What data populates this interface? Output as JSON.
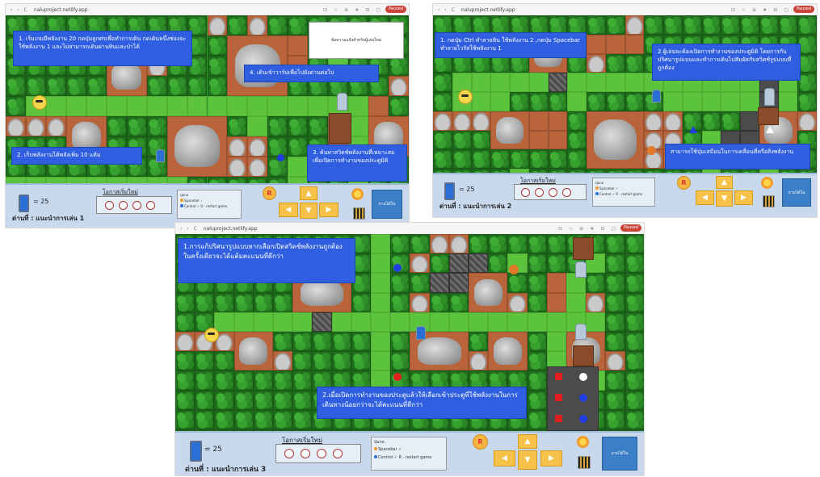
{
  "browser": {
    "url": "naluproject.netlify.app",
    "nav_glyphs": "‹ › C",
    "toolbar_glyphs": "⊡ ☆ ⊕ ★ ⊟ ▢",
    "profile_label": "Paused"
  },
  "screens": [
    {
      "notes": {
        "n1": "1. เริ่มเกมมีพลังงาน 20 กดปุ่มลูกศรเพื่อทำการเดิน กดเดินหนึ่งช่องจะใช้พลังงาน 1 และไม่สามารถเดินผ่านหินและป่าได้",
        "n2": "4. เดินเข้าวาร์ปเพื่อไปยังด่านต่อไป",
        "n3": "2. เก็บพลังงานได้พลังเพิ่ม 10 แต้ม",
        "n4": "3. ค้นหาสวิตช์พลังงานที่เหมาะสมเพื่อเปิดการทำงานของประตูมิติ"
      },
      "popup": "ข้อความแจ้งสำหรับผู้เล่นใหม่",
      "hud": {
        "energy": "= 25",
        "restart_label": "โอกาสเริ่มใหม่",
        "stage": "ด่านที่ : แนะนำการเล่น 1",
        "legend_title": "ปุ่มกด",
        "legend_line1": "Spacebar ✓",
        "legend_line2": "Control ✓",
        "legend_line3": "R - restart game",
        "finish": "ถามได้ใน"
      }
    },
    {
      "notes": {
        "n1": "1. กดปุ่ม Ctrl ทำลายหิน ใช้พลังงาน 2 ,กดปุ่ม Spacebar ทำลายไวรัสใช้พลังงาน 1",
        "n2": "2.ผู้เล่นจะต้องเปิดการทำงานของประตูมิติ โดยการกับปริศนารูปแบบและทำการเดินไปสัมผัสกับสวิตช์รูปแบบที่ถูกต้อง",
        "n3": "สามารถใช้ปุ่มเสมือนในการเคลื่อนที่หรือสิ่งพลังงาน"
      },
      "hud": {
        "energy": "= 25",
        "restart_label": "โอกาสเริ่มใหม่",
        "stage": "ด่านที่ : แนะนำการเล่น 2",
        "legend_title": "ปุ่มกด",
        "legend_line1": "Spacebar ✓",
        "legend_line2": "Control ✓",
        "legend_line3": "R - restart game",
        "finish": "ถามได้ใน"
      }
    },
    {
      "notes": {
        "n1": "1.การแก้ปริศนารูปแบบหากเลือกเปิดสวิตช์พลังงานถูกต้องในครั้งเดียวจะได้แต้มคะแนนที่ดีกว่า",
        "n2": "2.เมื่อเปิดการทำงานของประตูแล้วให้เลือกเข้าประตูที่ใช้พลังงานในการเดินทางน้อยกว่าจะได้คะแนนที่ดีกว่า"
      },
      "hud": {
        "energy": "= 25",
        "restart_label": "โอกาสเริ่มใหม่",
        "stage": "ด่านที่ : แนะนำการเล่น 3",
        "legend_title": "ปุ่มกด",
        "legend_line1": "Spacebar ✓",
        "legend_line2": "Control ✓",
        "legend_line3": "R - restart game",
        "finish": "ถามได้ใน"
      }
    }
  ],
  "controls": {
    "restart_button": "R",
    "arrow_up": "▲",
    "arrow_down": "▼",
    "arrow_left": "◀",
    "arrow_right": "▶"
  },
  "colors": {
    "note_bg": "#2f5fe0",
    "forest": "#1f6e1b",
    "path": "#5cc43c",
    "dirt": "#b9643a",
    "hud_bg": "#c8d9ee"
  }
}
